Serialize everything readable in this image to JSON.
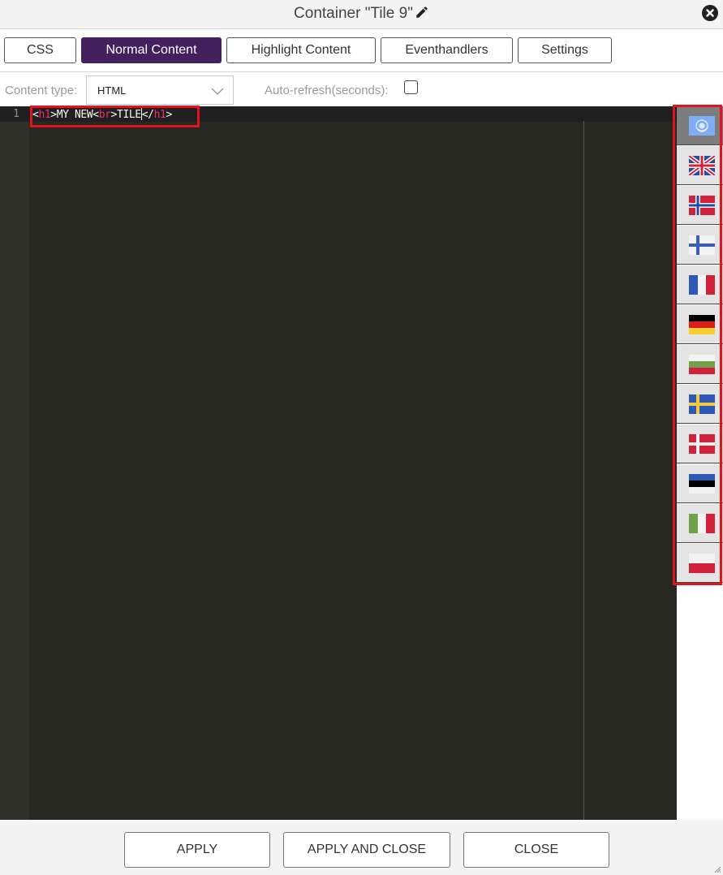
{
  "dialog": {
    "title": "Container \"Tile 9\"",
    "edit_icon": "pencil-icon",
    "close_icon": "close-circle-icon"
  },
  "tabs": [
    {
      "label": "CSS",
      "active": false
    },
    {
      "label": "Normal Content",
      "active": true
    },
    {
      "label": "Highlight Content",
      "active": false
    },
    {
      "label": "Eventhandlers",
      "active": false
    },
    {
      "label": "Settings",
      "active": false
    }
  ],
  "options": {
    "content_type_label": "Content type:",
    "content_type_value": "HTML",
    "auto_refresh_label": "Auto-refresh(seconds):",
    "auto_refresh_checked": false
  },
  "editor": {
    "line_numbers": [
      "1"
    ],
    "code_line_1": {
      "t1": "<",
      "t2": "h1",
      "t3": ">MY NEW",
      "t4": "<",
      "t5": "br",
      "t6": ">TILE",
      "t7": "</",
      "t8": "h1",
      "t9": ">"
    },
    "full_text": "<h1>MY NEW<br>TILE</h1>",
    "colors": {
      "background": "#272822",
      "tag": "#f92672",
      "text": "#f8f8f2"
    }
  },
  "languages": [
    {
      "code": "un",
      "name": "Default (UN)",
      "active": true
    },
    {
      "code": "gb",
      "name": "English",
      "active": false
    },
    {
      "code": "no",
      "name": "Norwegian",
      "active": false
    },
    {
      "code": "fi",
      "name": "Finnish",
      "active": false
    },
    {
      "code": "fr",
      "name": "French",
      "active": false
    },
    {
      "code": "de",
      "name": "German",
      "active": false
    },
    {
      "code": "bg",
      "name": "Bulgarian",
      "active": false
    },
    {
      "code": "se",
      "name": "Swedish",
      "active": false
    },
    {
      "code": "dk",
      "name": "Danish",
      "active": false
    },
    {
      "code": "ee",
      "name": "Estonian",
      "active": false
    },
    {
      "code": "it",
      "name": "Italian",
      "active": false
    },
    {
      "code": "pl",
      "name": "Polish",
      "active": false
    }
  ],
  "footer": {
    "apply": "APPLY",
    "apply_close": "APPLY AND CLOSE",
    "close": "CLOSE"
  },
  "colors": {
    "accent": "#45205f",
    "annotation_red": "#e0141e"
  }
}
